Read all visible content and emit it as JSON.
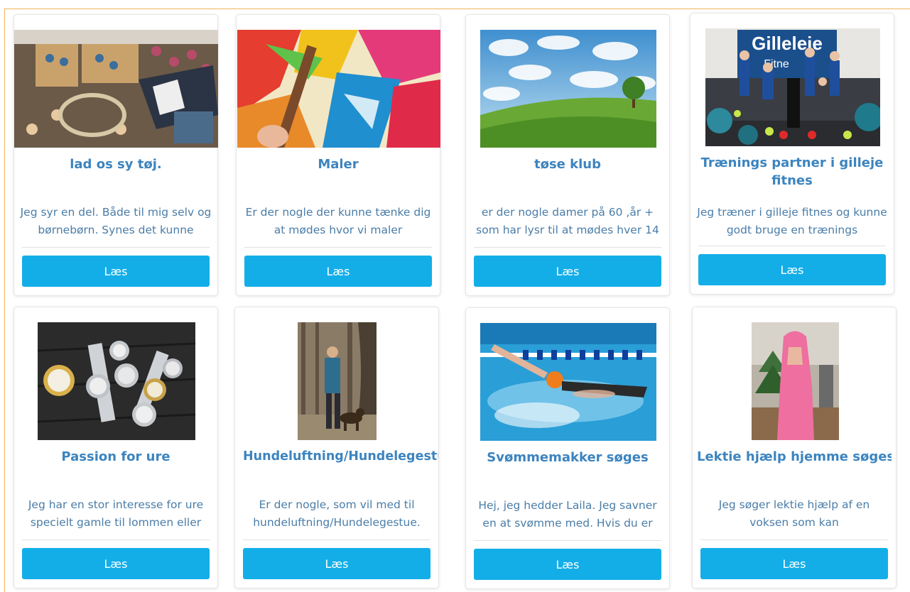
{
  "cards": [
    {
      "title": "lad os sy tøj.",
      "description": "Jeg syr en del. Både til mig selv og børnebørn. Synes det kunne",
      "button": "Læs"
    },
    {
      "title": "Maler",
      "description": "Er der nogle der kunne tænke dig at mødes hvor vi maler",
      "button": "Læs"
    },
    {
      "title": "tøse klub",
      "description": "er der nogle damer på 60 ,år + som har lysr til at mødes hver 14",
      "button": "Læs"
    },
    {
      "title": "Trænings partner i gilleje fitnes",
      "description": "Jeg træner i gilleje fitnes og kunne godt bruge en trænings",
      "button": "Læs"
    },
    {
      "title": "Passion for ure",
      "description": "Jeg har en stor interesse for ure specielt gamle til lommen eller",
      "button": "Læs"
    },
    {
      "title": "Hundeluftning/Hundelegestue",
      "description": "Er der nogle, som vil med til hundeluftning/Hundelegestue.",
      "button": "Læs"
    },
    {
      "title": "Svømmemakker søges",
      "description": "Hej, jeg hedder Laila. Jeg savner en at svømme med. Hvis du er",
      "button": "Læs"
    },
    {
      "title": "Lektie hjælp hjemme søges",
      "description": "Jeg søger lektie hjælp af en voksen som kan",
      "button": "Læs"
    }
  ],
  "image_texts": {
    "fitness_sign": "Gilleleje",
    "fitness_sign2": "Fitne"
  }
}
